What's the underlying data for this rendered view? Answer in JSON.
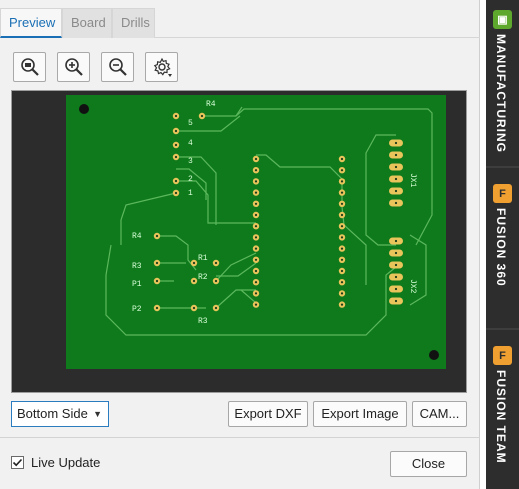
{
  "tabs": [
    {
      "label": "Preview",
      "active": true
    },
    {
      "label": "Board",
      "active": false
    },
    {
      "label": "Drills",
      "active": false
    }
  ],
  "toolbar": {
    "icons": [
      "zoom-fit-icon",
      "zoom-in-icon",
      "zoom-out-icon",
      "settings-gear-icon"
    ]
  },
  "pcb": {
    "board_color": "#0f7a1c",
    "trace_color": "#5cb85c",
    "pad_color": "#e8c45a",
    "labels": {
      "r4_top": "R4",
      "pin5": "5",
      "pin4": "4",
      "pin3": "3",
      "pin2": "2",
      "pin1": "1",
      "r4_left": "R4",
      "r1": "R1",
      "r3": "R3",
      "r2": "R2",
      "p1": "P1",
      "p2": "P2",
      "r3_bottom": "R3",
      "jx1": "JX1",
      "jx2": "JX2"
    }
  },
  "controls": {
    "side_value": "Bottom Side",
    "export_dxf": "Export DXF",
    "export_image": "Export Image",
    "cam": "CAM...",
    "live_update": "Live Update",
    "live_update_checked": true,
    "close": "Close"
  },
  "sidebar": {
    "items": [
      {
        "label": "MANUFACTURING",
        "badge": "▣",
        "badge_color": "#5fa82e"
      },
      {
        "label": "FUSION 360",
        "badge": "F",
        "badge_color": "#f0a030"
      },
      {
        "label": "FUSION TEAM",
        "badge": "F",
        "badge_color": "#f0a030"
      }
    ]
  }
}
